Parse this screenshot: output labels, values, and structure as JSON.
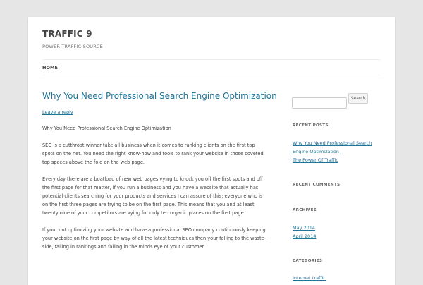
{
  "site": {
    "title": "TRAFFIC 9",
    "description": "POWER TRAFFIC SOURCE"
  },
  "nav": {
    "home": "HOME"
  },
  "post": {
    "title": "Why You Need Professional Search Engine Optimization",
    "reply_link": "Leave a reply",
    "paragraphs": [
      "Why You Need Professional Search Engine Optimization",
      "SEO is a cutthroat winner take all business when it comes to ranking clients on the first top spots on the net. You need the right know-how and tools to rank your website in those coveted top spaces above the fold on the web page.",
      "Every day there are a boatload of new web pages vying to knock you off the first spots and off the first page for that matter, if you run a business and you have a website that actually has potential clients searching for your products and services I can assure of this; everyone who is on the first three pages are trying to be on the first page. This means that you and at least twenty nine of your competitors are vying for only ten organic places on the first page.",
      "If your not optimizing your website and have a professional SEO company continuously keeping your website on the first page by way of all the latest techniques then your falling to the waste-side, falling in rankings and falling in the minds eye of your customer."
    ]
  },
  "sidebar": {
    "search_placeholder": "",
    "search_button": "Search",
    "recent_posts_title": "RECENT POSTS",
    "recent_posts": [
      "Why You Need Professional Search Engine Optimization",
      "The Power Of Traffic"
    ],
    "recent_comments_title": "RECENT COMMENTS",
    "archives_title": "ARCHIVES",
    "archives": [
      "May 2014",
      "April 2014"
    ],
    "categories_title": "CATEGORIES",
    "categories": [
      "Internet traffic"
    ]
  },
  "colors": {
    "background": "#e6e6e6",
    "link": "#21759b",
    "text": "#444444"
  }
}
